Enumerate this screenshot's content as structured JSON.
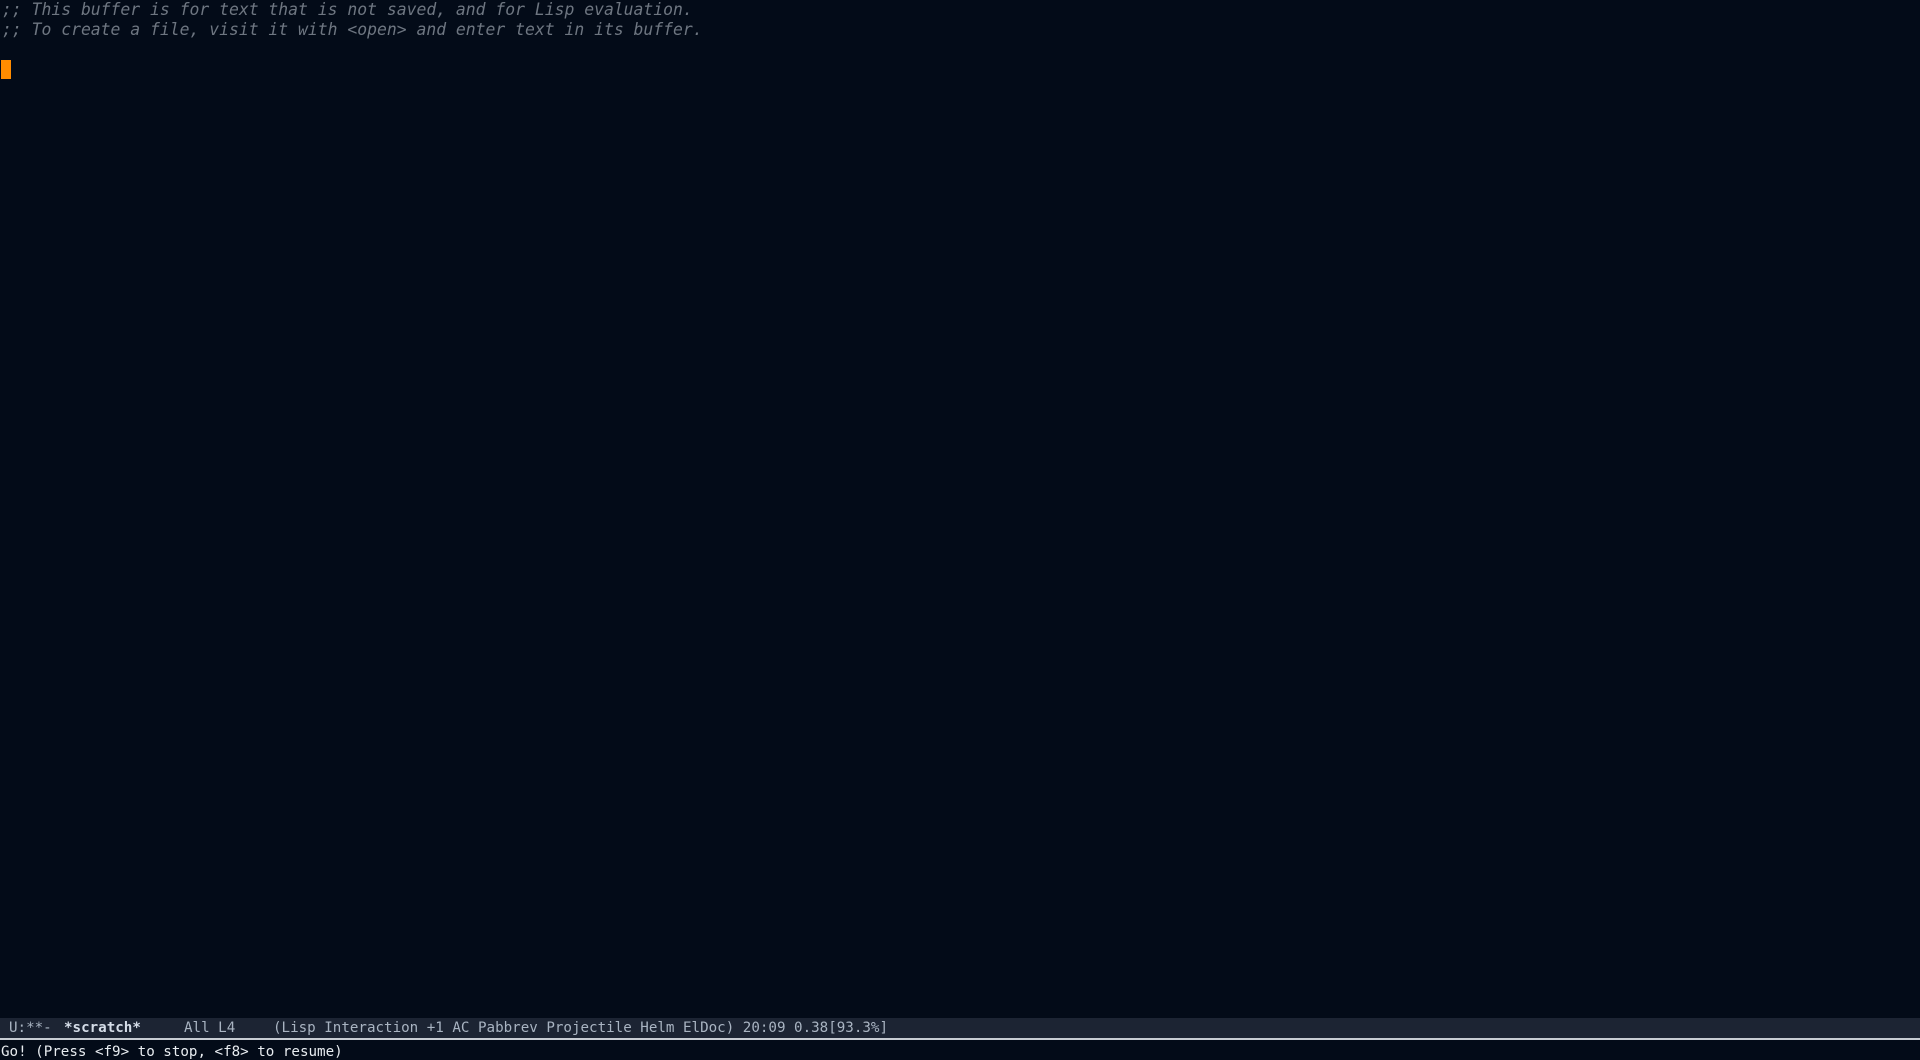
{
  "buffer": {
    "lines": [
      ";; This buffer is for text that is not saved, and for Lisp evaluation.",
      ";; To create a file, visit it with <open> and enter text in its buffer."
    ]
  },
  "mode_line": {
    "status": "U:**-",
    "buffer_name": "*scratch*",
    "position": "All L4",
    "modes": "(Lisp Interaction +1 AC Pabbrev Projectile Helm ElDoc) 20:09 0.38[93.3%]"
  },
  "echo_area": {
    "message": "Go! (Press <f9> to stop, <f8> to resume)"
  },
  "colors": {
    "background": "#030b18",
    "comment": "#6e7681",
    "cursor": "#ff8c00",
    "mode_line_bg": "#1c2433",
    "mode_line_fg": "#a9b4c2"
  }
}
